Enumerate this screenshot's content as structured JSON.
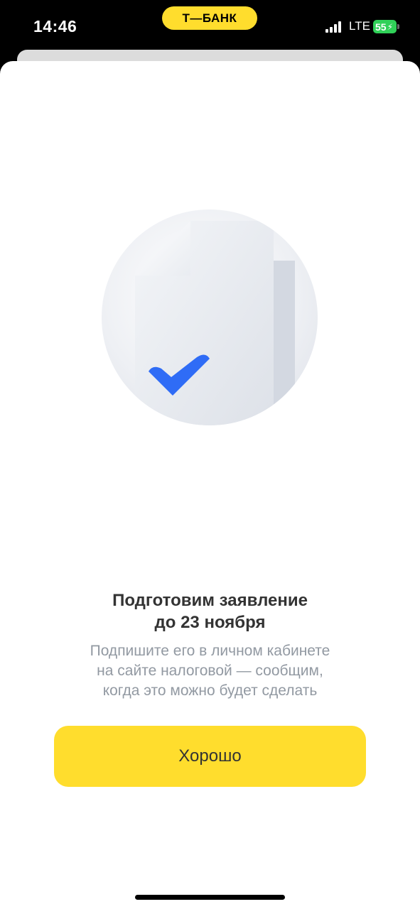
{
  "status_bar": {
    "time": "14:46",
    "brand": "Т—БАНК",
    "network": "LTE",
    "battery": "55"
  },
  "dialog": {
    "title_line1": "Подготовим заявление",
    "title_line2": "до 23 ноября",
    "subtitle_line1": "Подпишите его в личном кабинете",
    "subtitle_line2": "на сайте налоговой — сообщим,",
    "subtitle_line3": "когда это можно будет сделать",
    "button_label": "Хорошо",
    "illustration_icon": "document-check-icon"
  },
  "colors": {
    "accent": "#ffdd2d",
    "check": "#2f6cf6",
    "title_text": "#333333",
    "subtitle_text": "#9299a2"
  }
}
